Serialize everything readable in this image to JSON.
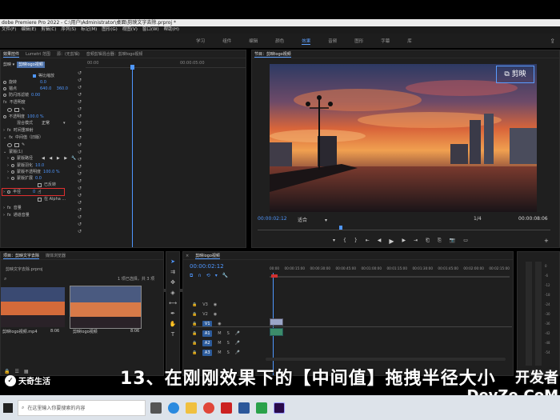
{
  "app": {
    "title": "dobe Premiere Pro 2022 - C:\\用户\\Administrator\\桌面\\剪映文字去除.prproj *"
  },
  "menu": [
    "文件(F)",
    "编辑(E)",
    "剪辑(C)",
    "序列(S)",
    "标记(M)",
    "图形(G)",
    "视图(V)",
    "窗口(W)",
    "帮助(H)"
  ],
  "workspaces": [
    "学习",
    "组件",
    "编辑",
    "颜色",
    "效果",
    "音频",
    "图形",
    "字幕",
    "库"
  ],
  "workspace_active": "效果",
  "effect_controls": {
    "tabs": [
      "效果控件",
      "Lumetri 范围",
      "源：(无剪辑)",
      "音频剪辑混合器：剪映logo视频"
    ],
    "header_clip": "剪映logo视频",
    "time_ruler": [
      "00:00",
      "00:00:05:00"
    ],
    "rows": [
      {
        "label": "等比缩放",
        "value": ""
      },
      {
        "label": "旋转",
        "value": "0.0"
      },
      {
        "label": "锚点",
        "value": "640.0    360.0"
      },
      {
        "label": "防闪烁滤镜",
        "value": "0.00"
      },
      {
        "label": "不透明度",
        "value": ""
      },
      {
        "label": "不透明度",
        "value": "100.0 %"
      },
      {
        "label": "混合模式",
        "value": "正常"
      },
      {
        "label": "时间重映射",
        "value": ""
      },
      {
        "label": "中间值（旧版）",
        "value": ""
      },
      {
        "label": "蒙版(1)",
        "value": ""
      },
      {
        "label": "蒙版路径",
        "value": ""
      },
      {
        "label": "蒙版羽化",
        "value": "10.0"
      },
      {
        "label": "蒙版不透明度",
        "value": "100.0 %"
      },
      {
        "label": "蒙版扩展",
        "value": "0.0"
      },
      {
        "label": "已反转",
        "value": ""
      },
      {
        "label": "半径",
        "value": "0"
      },
      {
        "label": "在 Alpha ...",
        "value": ""
      },
      {
        "label": "音量",
        "value": ""
      },
      {
        "label": "通道音量",
        "value": ""
      }
    ]
  },
  "program": {
    "tab": "节目：剪映logo视频",
    "timecode_left": "00:00:02:12",
    "fit": "适合",
    "zoom": "1/4",
    "timecode_right": "00:00:08:06",
    "watermark": "剪映"
  },
  "project": {
    "tabs": [
      "项目：剪映文字去除",
      "媒体浏览器"
    ],
    "file": "剪映文字去除.prproj",
    "selection": "1 项已选择，共 3 项",
    "items": [
      {
        "name": "剪映logo视频.mp4",
        "duration": "8:06"
      },
      {
        "name": "剪映logo视频",
        "duration": "8:06"
      }
    ]
  },
  "timeline": {
    "tab": "剪映logo视频",
    "timecode": "00:00:02:12",
    "ruler": [
      "00:00",
      "00:00:15:00",
      "00:00:30:00",
      "00:00:45:00",
      "00:01:00:00",
      "00:01:15:00",
      "00:01:30:00",
      "00:01:45:00",
      "00:02:00:00",
      "00:02:15:00"
    ],
    "tracks": [
      "V3",
      "V2",
      "V1",
      "A1",
      "A2",
      "A3"
    ]
  },
  "subtitle": "13、在刚刚效果下的【中间值】拖拽半径大小",
  "watermark_brand": "天奇生活",
  "corner_logo": "开发者 DevZe.CoM",
  "taskbar": {
    "search_placeholder": "在这里输入你要搜索的内容"
  },
  "colors": {
    "accent": "#4f97ff",
    "panel_bg": "#1f1f1f",
    "app_bg": "#000000"
  }
}
